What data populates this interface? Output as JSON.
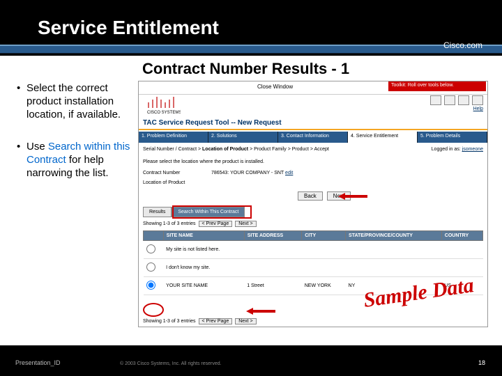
{
  "header": {
    "title": "Service Entitlement",
    "brand": "Cisco.com"
  },
  "subtitle": "Contract Number Results - 1",
  "bullets": [
    {
      "pre": "Select the correct product installation location, if available."
    },
    {
      "pre": "Use ",
      "hl": "Search within this Contract",
      "post": " for help narrowing the list."
    }
  ],
  "screenshot": {
    "close": "Close Window",
    "toolkit": "Toolkit: Roll over tools below.",
    "help": "Help",
    "h1": "TAC Service Request Tool -- New Request",
    "steps": [
      "1. Problem Definition",
      "2. Solutions",
      "3. Contact Information",
      "4. Service Entitlement",
      "5. Problem Details"
    ],
    "activeStep": 3,
    "crumb_pre": "Serial Number / Contract > ",
    "crumb_b": "Location of Product",
    "crumb_post": " > Product Family > Product > Accept",
    "loggedin_pre": "Logged in as: ",
    "loggedin_link": "jsomeone",
    "instr": "Please select the location where the product is installed.",
    "rows": [
      {
        "label": "Contract Number",
        "value": "786543: YOUR COMPANY - SNT",
        "link": "edit"
      },
      {
        "label": "Location of Product",
        "value": ""
      }
    ],
    "back": "Back",
    "next": "Next",
    "tabs": [
      "Results",
      "Search Within This Contract"
    ],
    "pager_text": "Showing 1-3 of 3 entries",
    "pager_prev": "< Prev Page",
    "pager_next": "Next >",
    "cols": [
      "",
      "SITE NAME",
      "SITE ADDRESS",
      "CITY",
      "STATE/PROVINCE/COUNTY",
      "COUNTRY"
    ],
    "data": [
      {
        "name": "My site is not listed here.",
        "addr": "",
        "city": "",
        "state": "",
        "country": ""
      },
      {
        "name": "I don't know my site.",
        "addr": "",
        "city": "",
        "state": "",
        "country": ""
      },
      {
        "name": "YOUR SITE NAME",
        "addr": "1 Street",
        "city": "NEW YORK",
        "state": "NY",
        "country": "US"
      }
    ]
  },
  "sample": "Sample Data",
  "footer": {
    "pid": "Presentation_ID",
    "cr": "© 2003 Cisco Systems, Inc. All rights reserved.",
    "pn": "18"
  }
}
